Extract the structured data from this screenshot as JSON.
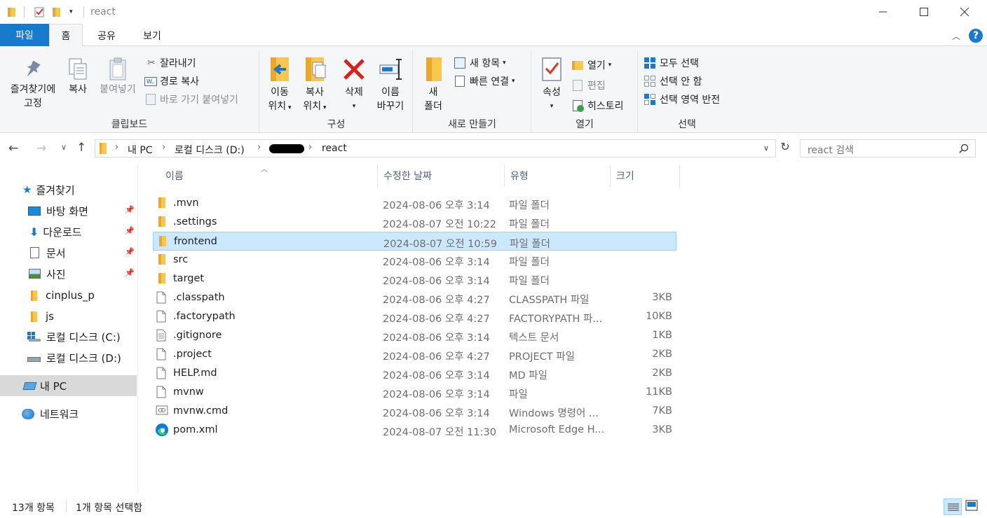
{
  "window": {
    "title": "react",
    "controls": [
      "minimize",
      "maximize",
      "close"
    ]
  },
  "ribbon_tabs": [
    {
      "label": "파일",
      "active": false
    },
    {
      "label": "홈",
      "active": true
    },
    {
      "label": "공유",
      "active": false
    },
    {
      "label": "보기",
      "active": false
    }
  ],
  "ribbon": {
    "clipboard": {
      "label": "클립보드",
      "pin": "즐겨찾기에\n고정",
      "pin_l1": "즐겨찾기에",
      "pin_l2": "고정",
      "copy": "복사",
      "paste": "붙여넣기",
      "cut": "잘라내기",
      "copy_path": "경로 복사",
      "paste_shortcut": "바로 가기 붙여넣기"
    },
    "organize": {
      "label": "구성",
      "move_l1": "이동",
      "move_l2": "위치",
      "copyto_l1": "복사",
      "copyto_l2": "위치",
      "delete": "삭제",
      "rename_l1": "이름",
      "rename_l2": "바꾸기"
    },
    "new": {
      "label": "새로 만들기",
      "folder_l1": "새",
      "folder_l2": "폴더",
      "new_item": "새 항목",
      "easy_access": "빠른 연결"
    },
    "open": {
      "label": "열기",
      "properties": "속성",
      "open": "열기",
      "edit": "편집",
      "history": "히스토리"
    },
    "select": {
      "label": "선택",
      "select_all": "모두 선택",
      "select_none": "선택 안 함",
      "invert": "선택 영역 반전"
    }
  },
  "address": {
    "crumbs": [
      "내 PC",
      "로컬 디스크 (D:)",
      "",
      "react"
    ],
    "search_placeholder": "react 검색"
  },
  "nav": {
    "quick_access": "즐겨찾기",
    "items": [
      {
        "label": "바탕 화면",
        "icon": "desktop-icon",
        "pinned": true
      },
      {
        "label": "다운로드",
        "icon": "download-icon",
        "pinned": true
      },
      {
        "label": "문서",
        "icon": "document-icon",
        "pinned": true
      },
      {
        "label": "사진",
        "icon": "pictures-icon",
        "pinned": true
      },
      {
        "label": "cinplus_p",
        "icon": "folder-icon",
        "pinned": false
      },
      {
        "label": "js",
        "icon": "folder-icon",
        "pinned": false
      },
      {
        "label": "로컬 디스크 (C:)",
        "icon": "drive-c-icon",
        "pinned": false
      },
      {
        "label": "로컬 디스크 (D:)",
        "icon": "drive-d-icon",
        "pinned": false
      }
    ],
    "this_pc": "내 PC",
    "network": "네트워크"
  },
  "columns": {
    "name": "이름",
    "date": "수정한 날짜",
    "type": "유형",
    "size": "크기"
  },
  "files": [
    {
      "name": ".mvn",
      "date": "2024-08-06 오후 3:14",
      "type": "파일 폴더",
      "size": "",
      "icon": "folder-icon"
    },
    {
      "name": ".settings",
      "date": "2024-08-07 오전 10:22",
      "type": "파일 폴더",
      "size": "",
      "icon": "folder-icon"
    },
    {
      "name": "frontend",
      "date": "2024-08-07 오전 10:59",
      "type": "파일 폴더",
      "size": "",
      "icon": "folder-icon",
      "selected": true
    },
    {
      "name": "src",
      "date": "2024-08-06 오후 3:14",
      "type": "파일 폴더",
      "size": "",
      "icon": "folder-icon"
    },
    {
      "name": "target",
      "date": "2024-08-06 오후 3:14",
      "type": "파일 폴더",
      "size": "",
      "icon": "folder-icon"
    },
    {
      "name": ".classpath",
      "date": "2024-08-06 오후 4:27",
      "type": "CLASSPATH 파일",
      "size": "3KB",
      "icon": "file-icon"
    },
    {
      "name": ".factorypath",
      "date": "2024-08-06 오후 4:27",
      "type": "FACTORYPATH 파...",
      "size": "10KB",
      "icon": "file-icon"
    },
    {
      "name": ".gitignore",
      "date": "2024-08-06 오후 3:14",
      "type": "텍스트 문서",
      "size": "1KB",
      "icon": "text-file-icon"
    },
    {
      "name": ".project",
      "date": "2024-08-06 오후 4:27",
      "type": "PROJECT 파일",
      "size": "2KB",
      "icon": "file-icon"
    },
    {
      "name": "HELP.md",
      "date": "2024-08-06 오후 3:14",
      "type": "MD 파일",
      "size": "2KB",
      "icon": "file-icon"
    },
    {
      "name": "mvnw",
      "date": "2024-08-06 오후 3:14",
      "type": "파일",
      "size": "11KB",
      "icon": "file-icon"
    },
    {
      "name": "mvnw.cmd",
      "date": "2024-08-06 오후 3:14",
      "type": "Windows 명령어 ...",
      "size": "7KB",
      "icon": "cmd-file-icon"
    },
    {
      "name": "pom.xml",
      "date": "2024-08-07 오전 11:30",
      "type": "Microsoft Edge H...",
      "size": "3KB",
      "icon": "edge-icon"
    }
  ],
  "status": {
    "count": "13개 항목",
    "selected": "1개 항목 선택함"
  },
  "colors": {
    "accent": "#1979ca",
    "selection": "#cce8ff",
    "folder": "#f8c74d"
  }
}
